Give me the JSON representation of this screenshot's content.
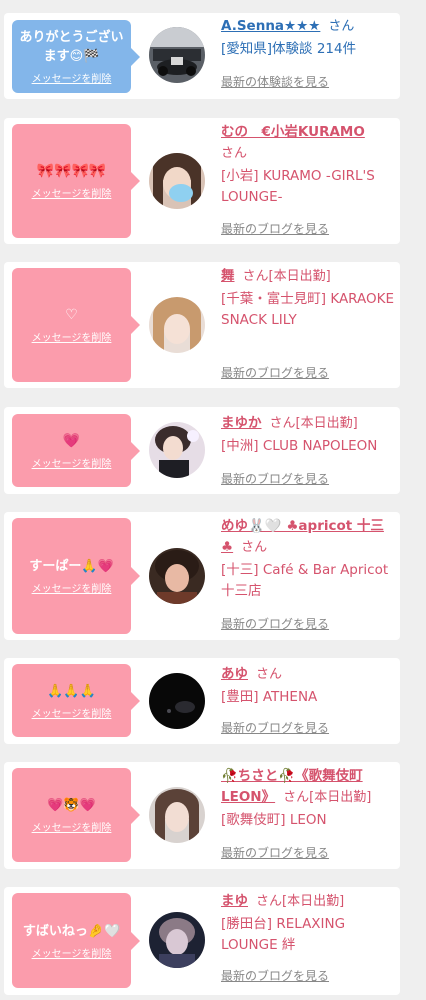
{
  "cards": [
    {
      "message": "ありがとうございます😊🏁",
      "delete_label": "メッセージを削除",
      "name": "A.Senna★★★",
      "san": "さん",
      "status": "",
      "shop": "[愛知県]体験談 214件",
      "more_link": "最新の体験談を見る",
      "bubble_color": "#83b6ea",
      "avatar": "racing-car-photo"
    },
    {
      "message": "🎀🎀🎀🎀",
      "delete_label": "メッセージを削除",
      "name": "むの　€小岩KURAMO",
      "san": "さん",
      "status": "",
      "shop": "[小岩] KURAMO -GIRL'S LOUNGE-",
      "more_link": "最新のブログを見る",
      "bubble_color": "#fb9cac",
      "avatar": "girl-photo-face-covered"
    },
    {
      "message": "♡",
      "delete_label": "メッセージを削除",
      "name": "舞",
      "san": "さん",
      "status": "[本日出勤]",
      "shop": "[千葉・富士見町] KARAOKE SNACK LILY",
      "more_link": "最新のブログを見る",
      "bubble_color": "#fb9cac",
      "avatar": "girl-photo-blonde"
    },
    {
      "message": "💗",
      "delete_label": "メッセージを削除",
      "name": "まゆか",
      "san": "さん",
      "status": "[本日出勤]",
      "shop": "[中洲] CLUB NAPOLEON",
      "more_link": "最新のブログを見る",
      "bubble_color": "#fb9cac",
      "avatar": "girl-photo-dress"
    },
    {
      "message": "すーぱー🙏💗",
      "delete_label": "メッセージを削除",
      "name": "めゆ🐰🤍 ♣apricot 十三♣",
      "san": "さん",
      "status": "",
      "shop": "[十三] Café & Bar Apricot 十三店",
      "more_link": "最新のブログを見る",
      "bubble_color": "#fb9cac",
      "avatar": "girl-photo-dark"
    },
    {
      "message": "🙏🙏🙏",
      "delete_label": "メッセージを削除",
      "name": "あゆ",
      "san": "さん",
      "status": "",
      "shop": "[豊田] ATHENA",
      "more_link": "最新のブログを見る",
      "bubble_color": "#fb9cac",
      "avatar": "dark-photo"
    },
    {
      "message": "💗🐯💗",
      "delete_label": "メッセージを削除",
      "name": "🥀ちさと🥀《歌舞伎町LEON》",
      "san": "さん",
      "status": "[本日出勤]",
      "shop": "[歌舞伎町] LEON",
      "more_link": "最新のブログを見る",
      "bubble_color": "#fb9cac",
      "avatar": "girl-photo-long-hair"
    },
    {
      "message": "すばいねっ🤌🤍",
      "delete_label": "メッセージを削除",
      "name": "まゆ",
      "san": "さん",
      "status": "[本日出勤]",
      "shop": "[勝田台] RELAXING LOUNGE 絆",
      "more_link": "最新のブログを見る",
      "bubble_color": "#fb9cac",
      "avatar": "girl-photo-night"
    }
  ]
}
